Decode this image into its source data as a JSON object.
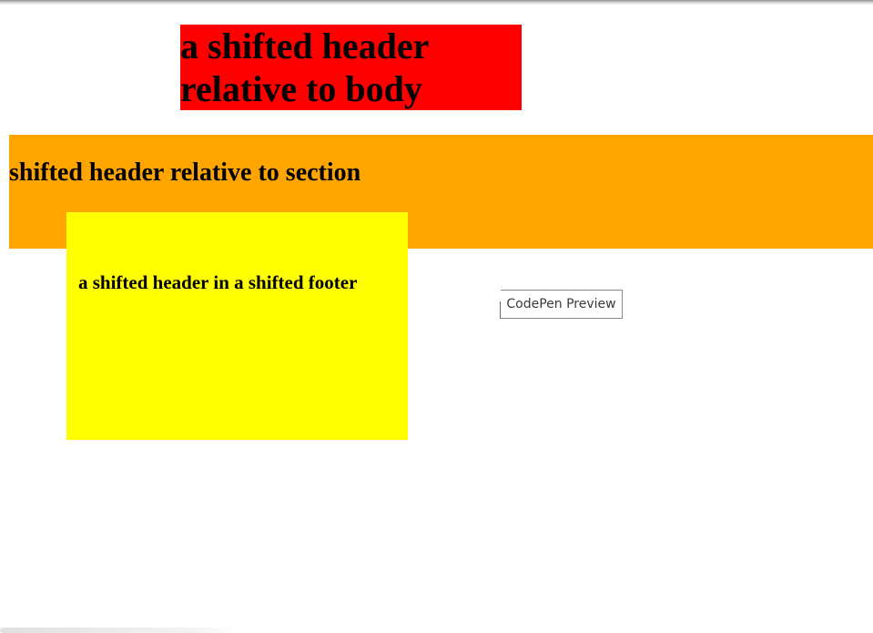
{
  "body_header": {
    "text": "a shifted header relative to body",
    "background": "#ff0000"
  },
  "section": {
    "header_text": "shifted header relative to section",
    "background": "#ffa500"
  },
  "footer": {
    "header_text": "a shifted header in a shifted footer",
    "background": "#ffff00"
  },
  "preview_button": {
    "label": "CodePen Preview"
  }
}
